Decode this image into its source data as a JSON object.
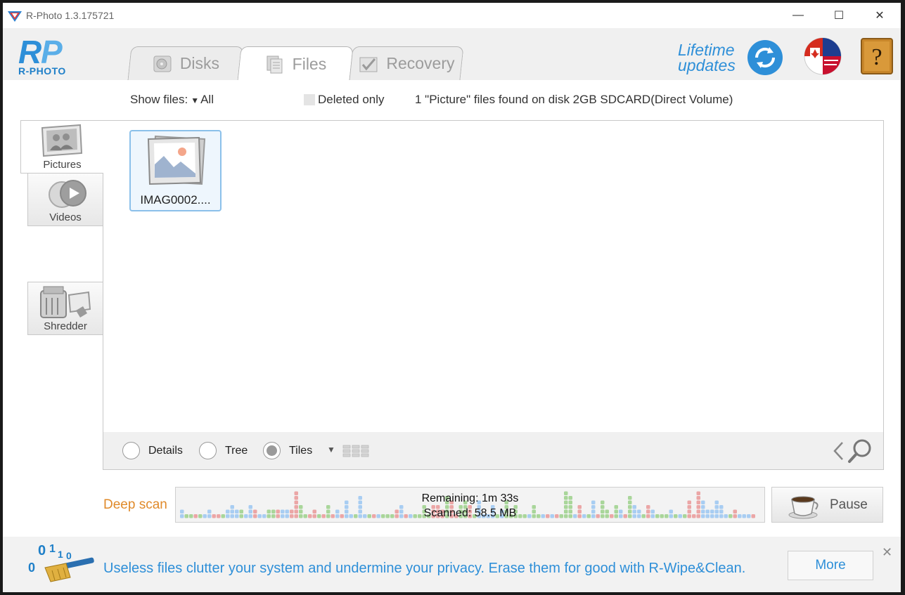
{
  "window": {
    "title": "R-Photo 1.3.175721",
    "minimize_glyph": "—",
    "maximize_glyph": "☐",
    "close_glyph": "✕"
  },
  "header": {
    "logo_text": "R-PHOTO",
    "tabs": [
      {
        "label": "Disks",
        "icon": "disk-icon",
        "active": false
      },
      {
        "label": "Files",
        "icon": "files-icon",
        "active": true
      },
      {
        "label": "Recovery",
        "icon": "recovery-icon",
        "active": false
      }
    ],
    "lifetime_line1": "Lifetime",
    "lifetime_line2": "updates"
  },
  "toolbar": {
    "show_files_label": "Show files:",
    "show_files_value": "All",
    "deleted_only_label": "Deleted only",
    "status": "1 \"Picture\" files found on disk 2GB SDCARD(Direct Volume)"
  },
  "sidebar": {
    "items": [
      {
        "label": "Pictures",
        "icon": "pictures-icon",
        "selected": true
      },
      {
        "label": "Videos",
        "icon": "videos-icon",
        "selected": false
      },
      {
        "label": "Shredder",
        "icon": "shredder-icon",
        "selected": false
      }
    ]
  },
  "files": [
    {
      "name": "IMAG0002....",
      "icon": "image-file-icon",
      "selected": true
    }
  ],
  "view_options": {
    "details": "Details",
    "tree": "Tree",
    "tiles": "Tiles",
    "selected": "Tiles"
  },
  "scan": {
    "label": "Deep scan",
    "remaining": "Remaining: 1m 33s",
    "scanned": "Scanned: 58.5 MB",
    "pause_label": "Pause"
  },
  "footer": {
    "ad_text": "Useless files clutter your system and undermine your privacy. Erase them for good with R-Wipe&Clean.",
    "more_label": "More",
    "close_glyph": "✕"
  },
  "colors": {
    "accent_blue": "#2e8fd8",
    "scan_orange": "#e08a2a",
    "scan_blue": "#a8cdf2",
    "scan_green": "#a9d69a",
    "scan_red": "#eba6a6"
  }
}
